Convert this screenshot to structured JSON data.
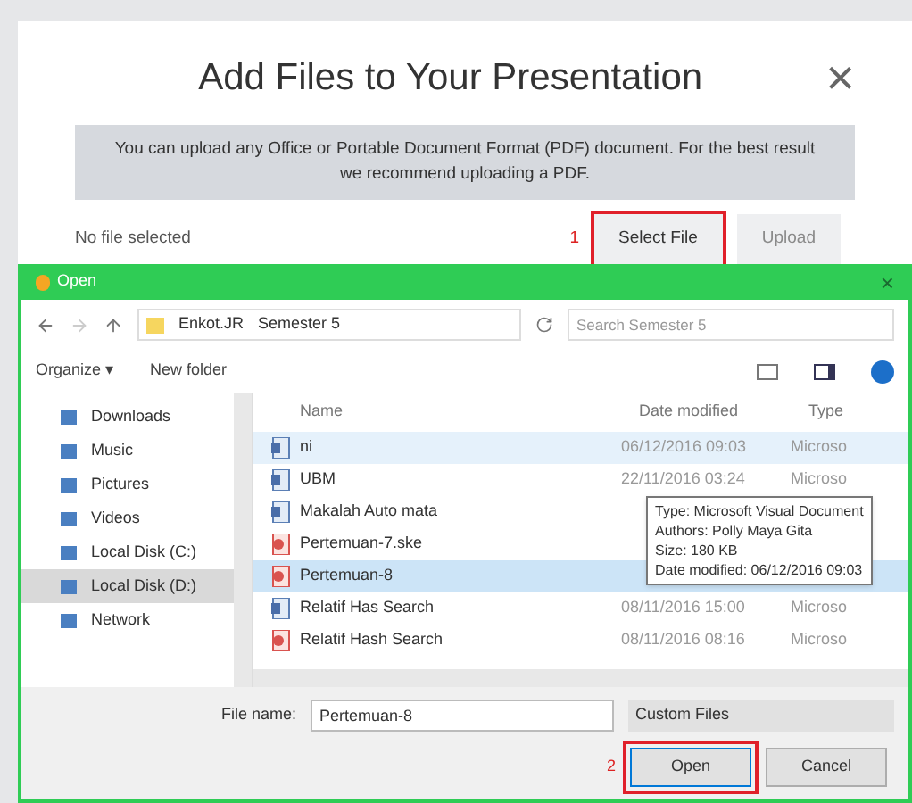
{
  "upload_dialog": {
    "title": "Add Files to Your Presentation",
    "close": "×",
    "info": "You can upload any Office or Portable Document Format (PDF) document.  For the best result we recommend uploading a PDF.",
    "status": "No file selected",
    "step_marker": "1",
    "buttons": [
      {
        "label": "Select File",
        "disabled": false,
        "highlighted": true
      },
      {
        "label": "Upload",
        "disabled": true,
        "highlighted": false
      }
    ]
  },
  "open_dialog": {
    "title": "Open",
    "close": "×",
    "breadcrumb": [
      "Enkot.JR",
      "Semester 5"
    ],
    "search": {
      "placeholder": "Search Semester 5"
    },
    "toolbar": [
      "Organize ▾",
      "New folder"
    ],
    "sidebar": [
      {
        "label": "Downloads",
        "selected": false
      },
      {
        "label": "Music",
        "selected": false
      },
      {
        "label": "Pictures",
        "selected": false
      },
      {
        "label": "Videos",
        "selected": false
      },
      {
        "label": "Local Disk (C:)",
        "selected": false
      },
      {
        "label": "Local Disk (D:)",
        "selected": true
      },
      {
        "label": "Network",
        "selected": false
      }
    ],
    "columns": [
      "Name",
      "Date modified",
      "Type"
    ],
    "files": [
      {
        "name": "ni",
        "date": "06/12/2016 09:03",
        "type": "Microso",
        "kind": "doc",
        "selected": false,
        "hovered": true
      },
      {
        "name": "UBM",
        "date": "22/11/2016 03:24",
        "type": "Microso",
        "kind": "doc",
        "selected": false,
        "hovered": false
      },
      {
        "name": "Makalah Auto mata",
        "kind": "doc",
        "selected": false,
        "hovered": false
      },
      {
        "name": "Pertemuan-7.ske",
        "kind": "pdf",
        "selected": false,
        "hovered": false
      },
      {
        "name": "Pertemuan-8",
        "kind": "pdf",
        "selected": true,
        "hovered": false
      },
      {
        "name": "Relatif Has Search",
        "date": "08/11/2016 15:00",
        "type": "Microso",
        "kind": "doc",
        "selected": false,
        "hovered": false
      },
      {
        "name": "Relatif Hash Search",
        "date": "08/11/2016 08:16",
        "type": "Microso",
        "kind": "pdf",
        "selected": false,
        "hovered": false
      }
    ],
    "tooltip": [
      "Type: Microsoft Visual Document",
      "Authors: Polly Maya Gita",
      "Size: 180 KB",
      "Date modified: 06/12/2016 09:03"
    ],
    "file_name_label": "File name:",
    "file_name": "Pertemuan-8",
    "filter": "Custom Files",
    "step_marker": "2",
    "buttons": [
      {
        "label": "Open",
        "highlighted": true
      },
      {
        "label": "Cancel",
        "highlighted": false
      }
    ]
  }
}
